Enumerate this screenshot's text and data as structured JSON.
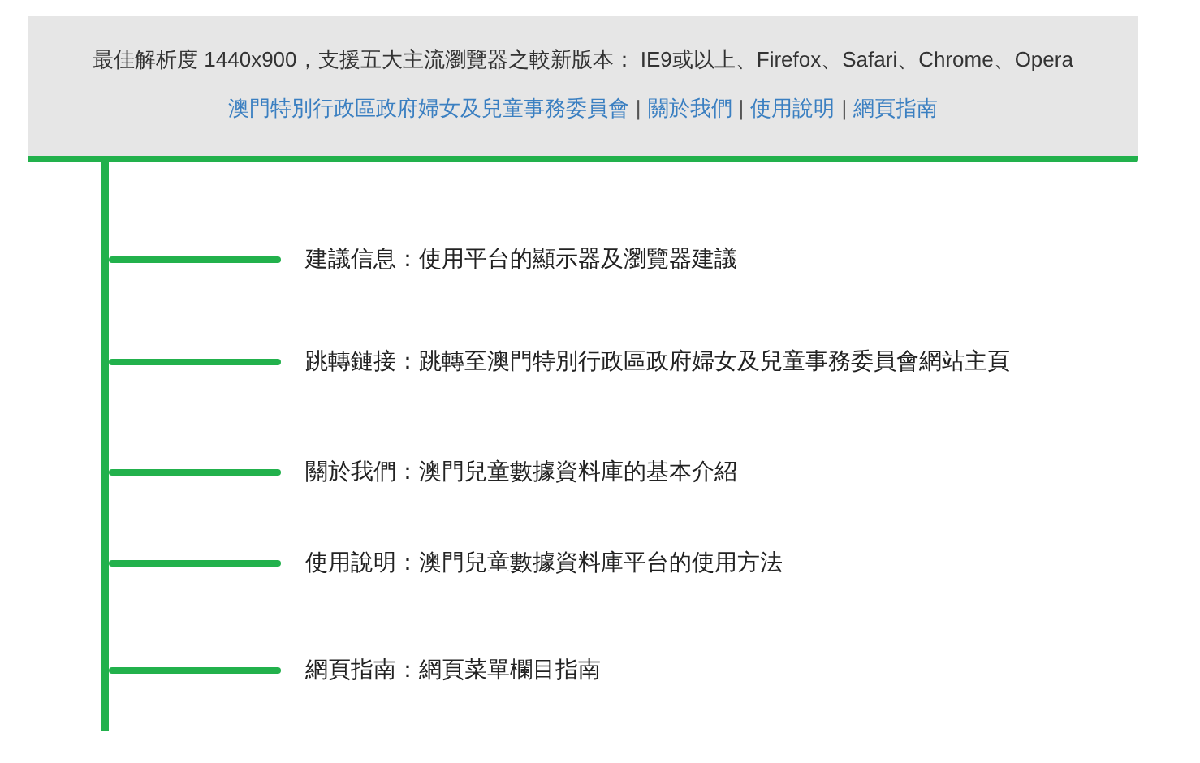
{
  "notice": {
    "text": "最佳解析度 1440x900，支援五大主流瀏覽器之較新版本： IE9或以上、Firefox、Safari、Chrome、Opera"
  },
  "links": [
    {
      "kind": "link",
      "label": "澳門特別行政區政府婦女及兒童事務委員會"
    },
    {
      "kind": "separator",
      "label": "|"
    },
    {
      "kind": "link",
      "label": "關於我們"
    },
    {
      "kind": "separator",
      "label": "|"
    },
    {
      "kind": "link",
      "label": "使用說明"
    },
    {
      "kind": "separator",
      "label": "|"
    },
    {
      "kind": "link",
      "label": "網頁指南"
    }
  ],
  "guide_items": [
    {
      "text": "建議信息：使用平台的顯示器及瀏覽器建議"
    },
    {
      "text": "跳轉鏈接：跳轉至澳門特別行政區政府婦女及兒童事務委員會網站主頁"
    },
    {
      "text": "關於我們：澳門兒童數據資料庫的基本介紹"
    },
    {
      "text": "使用說明：澳門兒童數據資料庫平台的使用方法"
    },
    {
      "text": "網頁指南：網頁菜單欄目指南"
    }
  ]
}
